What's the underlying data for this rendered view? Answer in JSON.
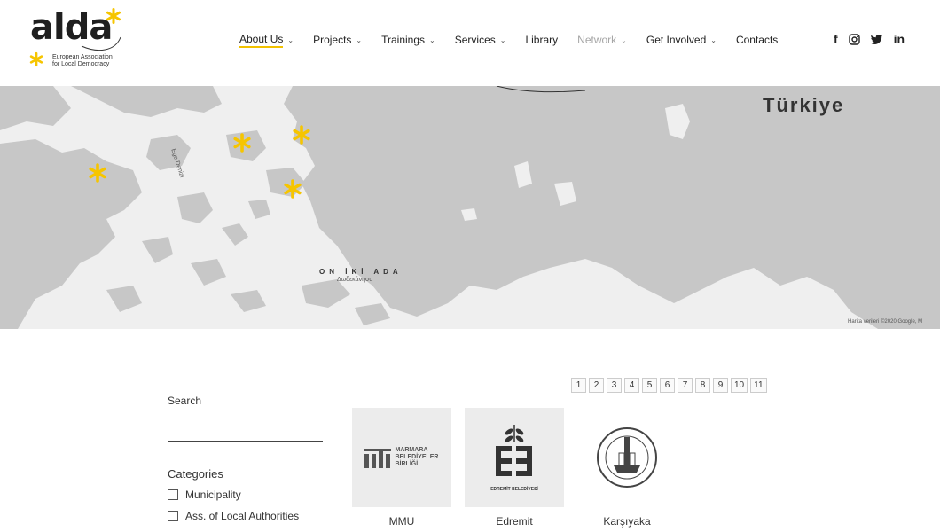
{
  "logo": {
    "word": "alda",
    "tagline_line1": "European Association",
    "tagline_line2": "for Local Democracy",
    "accent": "#f6c500"
  },
  "nav": {
    "items": [
      {
        "label": "About Us",
        "has_dropdown": true,
        "state": "active"
      },
      {
        "label": "Projects",
        "has_dropdown": true,
        "state": "normal"
      },
      {
        "label": "Trainings",
        "has_dropdown": true,
        "state": "normal"
      },
      {
        "label": "Services",
        "has_dropdown": true,
        "state": "normal"
      },
      {
        "label": "Library",
        "has_dropdown": false,
        "state": "normal"
      },
      {
        "label": "Network",
        "has_dropdown": true,
        "state": "muted"
      },
      {
        "label": "Get Involved",
        "has_dropdown": true,
        "state": "normal"
      },
      {
        "label": "Contacts",
        "has_dropdown": false,
        "state": "normal"
      }
    ],
    "social": [
      {
        "icon": "facebook-icon",
        "glyph": "f"
      },
      {
        "icon": "instagram-icon",
        "glyph": "◎"
      },
      {
        "icon": "twitter-icon",
        "glyph": "🐦"
      },
      {
        "icon": "linkedin-icon",
        "glyph": "in"
      }
    ]
  },
  "map": {
    "country_label": "Türkiye",
    "sea_label": "Ege Denizi",
    "islands_label": "ON İKİ ADA",
    "islands_sub": "Δωδεκάνησα",
    "attribution": "Harita verileri ©2020 Google, M",
    "land_color": "#c7c7c7",
    "water_color": "#efefef",
    "marker_color": "#f6c500"
  },
  "sidebar": {
    "search_label": "Search",
    "search_value": "",
    "categories_title": "Categories",
    "categories": [
      "Municipality",
      "Ass. of Local Authorities"
    ]
  },
  "pagination": [
    "1",
    "2",
    "3",
    "4",
    "5",
    "6",
    "7",
    "8",
    "9",
    "10",
    "11"
  ],
  "cards": [
    {
      "label": "MMU",
      "logo_text_1": "MARMARA",
      "logo_text_2": "BELEDİYELER",
      "logo_text_3": "BİRLİĞİ"
    },
    {
      "label": "Edremit",
      "logo_text_1": "EDREMİT BELEDİYESİ"
    },
    {
      "label": "Karşıyaka",
      "logo_text_1": ""
    }
  ]
}
